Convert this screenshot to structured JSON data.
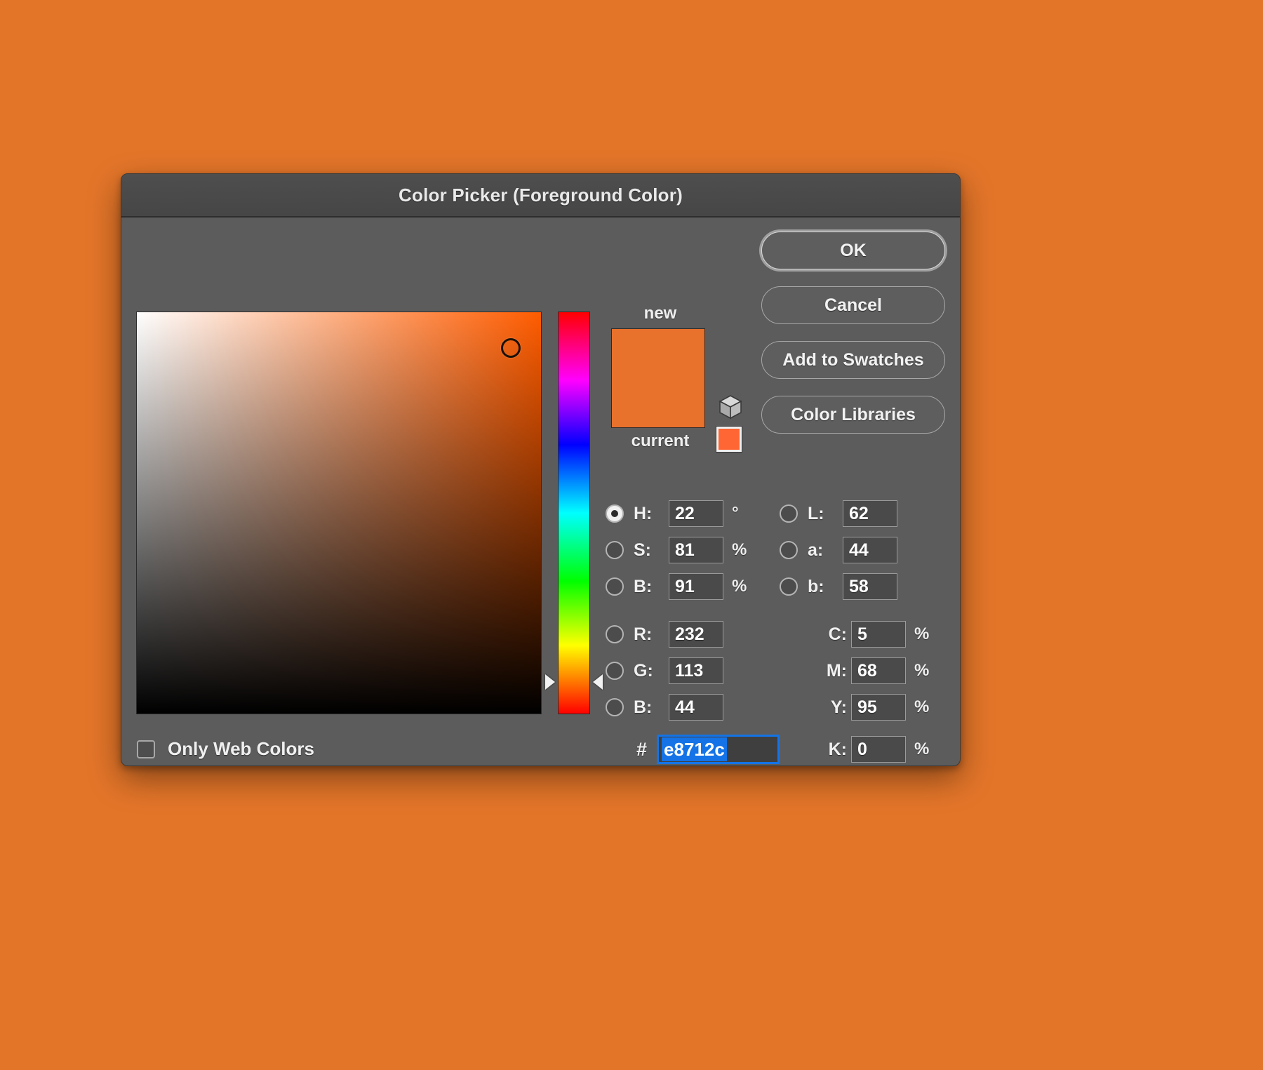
{
  "page": {
    "background_color": "#e37529"
  },
  "dialog": {
    "title": "Color Picker (Foreground Color)",
    "colors": {
      "new": "#e8712c",
      "current": "#e8712c",
      "web_safe": "#ff6633",
      "hue_color": "#ff5c00",
      "dialog_bg": "#5c5c5c",
      "titlebar_bg": "#4a4a4a",
      "selection_blue": "#1473e6"
    },
    "sv_field": {
      "name": "saturation-brightness-field",
      "cursor_x_pct": 92.5,
      "cursor_y_pct": 9.0
    },
    "hue_slider": {
      "name": "hue-slider",
      "marker_y_pct": 92.0
    },
    "options": {
      "only_web_colors_label": "Only Web Colors",
      "only_web_colors_checked": false
    },
    "preview": {
      "new_label": "new",
      "current_label": "current"
    },
    "buttons": [
      {
        "label": "OK",
        "primary": true
      },
      {
        "label": "Cancel",
        "primary": false
      },
      {
        "label": "Add to Swatches",
        "primary": false
      },
      {
        "label": "Color Libraries",
        "primary": false
      }
    ],
    "fields": {
      "hsb": [
        {
          "label": "H:",
          "value": "22",
          "unit": "°",
          "selected": true
        },
        {
          "label": "S:",
          "value": "81",
          "unit": "%",
          "selected": false
        },
        {
          "label": "B:",
          "value": "91",
          "unit": "%",
          "selected": false
        }
      ],
      "lab": [
        {
          "label": "L:",
          "value": "62",
          "unit": "",
          "selected": false
        },
        {
          "label": "a:",
          "value": "44",
          "unit": "",
          "selected": false
        },
        {
          "label": "b:",
          "value": "58",
          "unit": "",
          "selected": false
        }
      ],
      "rgb": [
        {
          "label": "R:",
          "value": "232",
          "unit": "",
          "selected": false
        },
        {
          "label": "G:",
          "value": "113",
          "unit": "",
          "selected": false
        },
        {
          "label": "B:",
          "value": "44",
          "unit": "",
          "selected": false
        }
      ],
      "cmyk": [
        {
          "label": "C:",
          "value": "5",
          "unit": "%"
        },
        {
          "label": "M:",
          "value": "68",
          "unit": "%"
        },
        {
          "label": "Y:",
          "value": "95",
          "unit": "%"
        },
        {
          "label": "K:",
          "value": "0",
          "unit": "%"
        }
      ],
      "hex": {
        "prefix": "#",
        "value": "e8712c",
        "selected": true
      }
    }
  }
}
